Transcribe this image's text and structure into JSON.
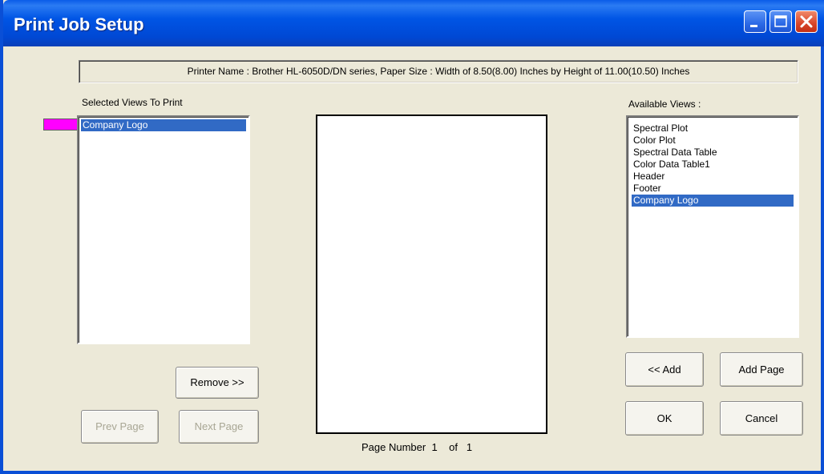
{
  "window": {
    "title": "Print Job Setup"
  },
  "printer_info": "Printer Name : Brother HL-6050D/DN series, Paper Size : Width of 8.50(8.00) Inches by Height of 11.00(10.50) Inches",
  "selected_views": {
    "label": "Selected Views To Print",
    "swatch_color": "#ff00ff",
    "items": [
      {
        "label": "Company Logo",
        "selected": true
      }
    ]
  },
  "available_views": {
    "label": "Available Views :",
    "items": [
      {
        "label": "Spectral Plot",
        "selected": false
      },
      {
        "label": "Color Plot",
        "selected": false
      },
      {
        "label": "Spectral Data Table",
        "selected": false
      },
      {
        "label": "Color Data Table1",
        "selected": false
      },
      {
        "label": "Header",
        "selected": false
      },
      {
        "label": "Footer",
        "selected": false
      },
      {
        "label": "Company Logo",
        "selected": true
      }
    ]
  },
  "buttons": {
    "remove": "Remove >>",
    "prev_page": "Prev Page",
    "next_page": "Next Page",
    "add": "<< Add",
    "add_page": "Add Page",
    "ok": "OK",
    "cancel": "Cancel"
  },
  "page_number": {
    "label": "Page Number",
    "current": "1",
    "of_label": "of",
    "total": "1"
  }
}
